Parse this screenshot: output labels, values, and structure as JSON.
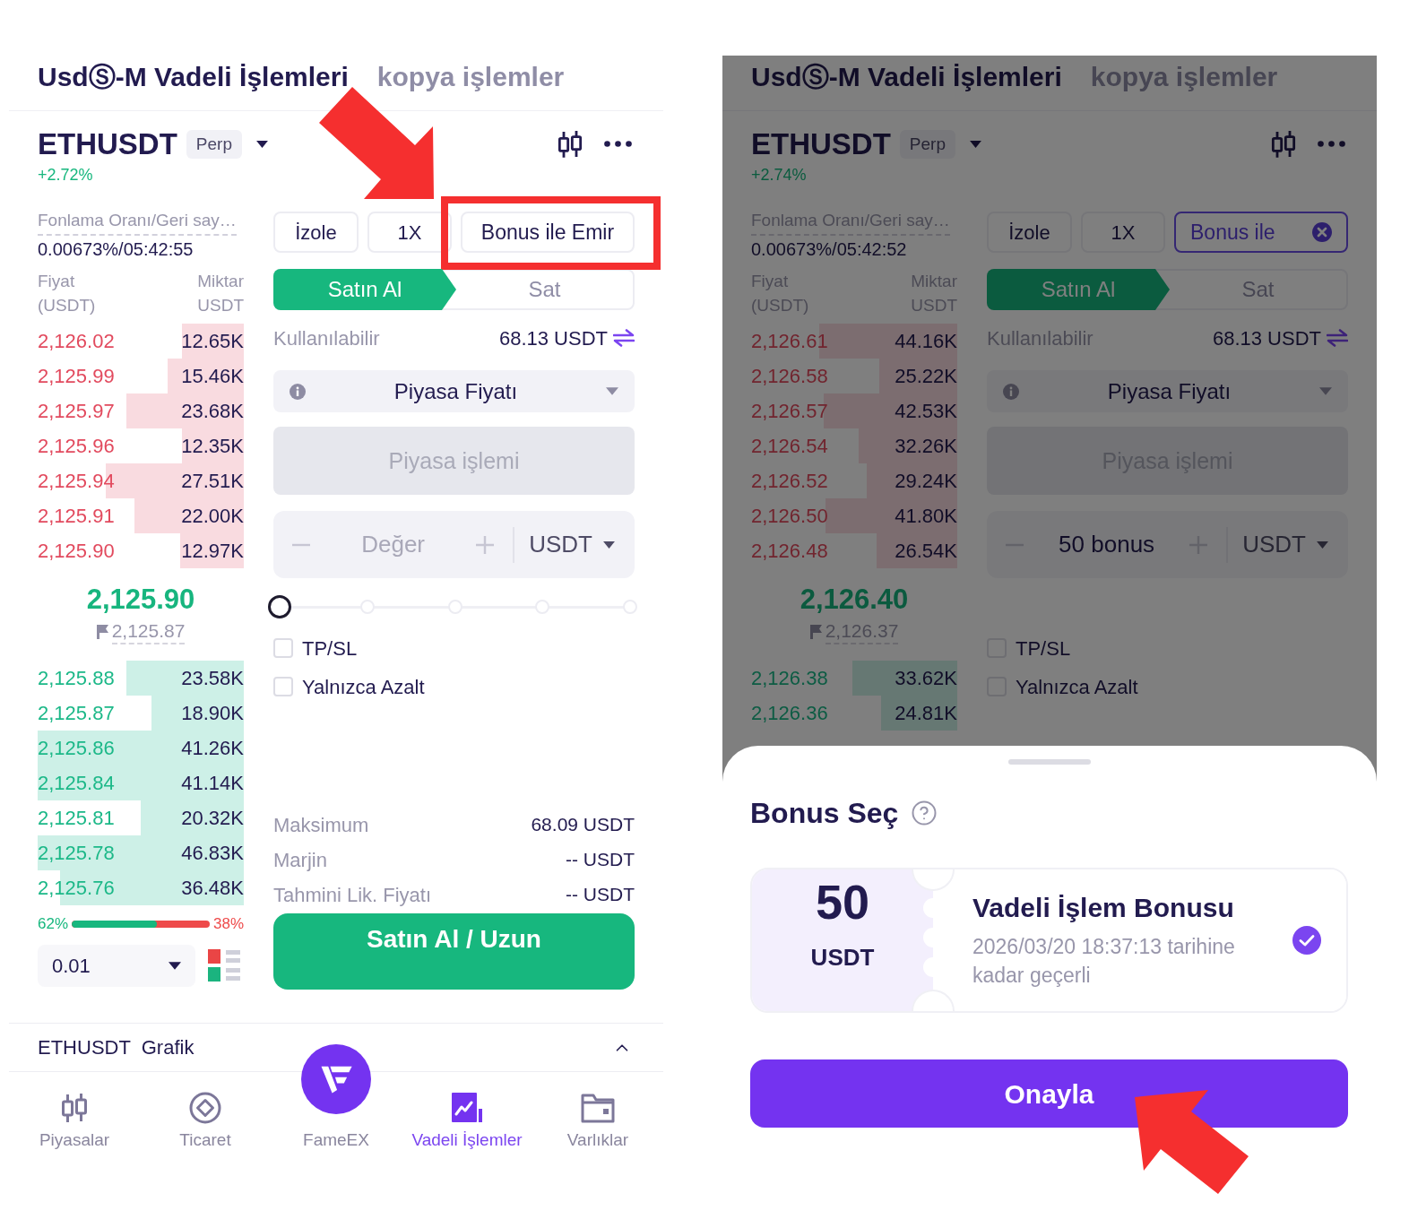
{
  "screens": [
    {
      "header_tabs": [
        {
          "label": "UsdⓈ-M Vadeli İşlemleri",
          "selected": true
        },
        {
          "label": "kopya işlemler",
          "selected": false
        }
      ],
      "symbol": {
        "name": "ETHUSDT",
        "badge": "Perp",
        "change": "+2.72%"
      },
      "funding": {
        "label": "Fonlama Oranı/Geri say…",
        "value": "0.00673%/05:42:55"
      },
      "order_book": {
        "price_label": "Fiyat",
        "price_unit": "(USDT)",
        "amount_label": "Miktar",
        "amount_unit": "USDT",
        "asks": [
          {
            "price": "2,126.02",
            "amount": "12.65K",
            "level": 0.3
          },
          {
            "price": "2,125.99",
            "amount": "15.46K",
            "level": 0.37
          },
          {
            "price": "2,125.97",
            "amount": "23.68K",
            "level": 0.57
          },
          {
            "price": "2,125.96",
            "amount": "12.35K",
            "level": 0.3
          },
          {
            "price": "2,125.94",
            "amount": "27.51K",
            "level": 0.67
          },
          {
            "price": "2,125.91",
            "amount": "22.00K",
            "level": 0.53
          },
          {
            "price": "2,125.90",
            "amount": "12.97K",
            "level": 0.31
          }
        ],
        "last_price": "2,125.90",
        "mark_price": "2,125.87",
        "bids": [
          {
            "price": "2,125.88",
            "amount": "23.58K",
            "level": 0.57
          },
          {
            "price": "2,125.87",
            "amount": "18.90K",
            "level": 0.45
          },
          {
            "price": "2,125.86",
            "amount": "41.26K",
            "level": 1
          },
          {
            "price": "2,125.84",
            "amount": "41.14K",
            "level": 1
          },
          {
            "price": "2,125.81",
            "amount": "20.32K",
            "level": 0.5
          },
          {
            "price": "2,125.78",
            "amount": "46.83K",
            "level": 1
          },
          {
            "price": "2,125.76",
            "amount": "36.48K",
            "level": 0.89
          }
        ],
        "ratio": {
          "buy": "62%",
          "sell": "38%",
          "level": 0.62
        },
        "precision": "0.01"
      },
      "margin_mode": "İzole",
      "leverage": "1X",
      "bonus_button": {
        "label": "Bonus ile Emir",
        "selected": false,
        "callout": true
      },
      "side_tabs": [
        {
          "label": "Satın Al",
          "selected": true
        },
        {
          "label": "Sat",
          "selected": false
        }
      ],
      "available": {
        "label": "Kullanılabilir",
        "value": "68.13 USDT"
      },
      "order_type": "Piyasa Fiyatı",
      "price_field": {
        "placeholder": "Piyasa işlemi",
        "disabled": true
      },
      "amount_field": {
        "placeholder": "Değer",
        "unit": "USDT"
      },
      "slider": {
        "level": 0
      },
      "options": [
        {
          "label": "TP/SL",
          "checked": false
        },
        {
          "label": "Yalnızca Azalt",
          "checked": false
        }
      ],
      "summary": [
        {
          "label": "Maksimum",
          "value": "68.09 USDT"
        },
        {
          "label": "Marjin",
          "value": "-- USDT"
        },
        {
          "label": "Tahmini Lik. Fiyatı",
          "value": "-- USDT"
        }
      ],
      "submit_button": "Satın Al / Uzun",
      "chart_bar": {
        "label": "ETHUSDT  Grafik"
      },
      "bottom_nav": [
        {
          "kind": "markets",
          "label": "Piyasalar",
          "selected": false
        },
        {
          "kind": "trade",
          "label": "Ticaret",
          "selected": false
        },
        {
          "kind": "home",
          "label": "FameEX",
          "selected": false
        },
        {
          "kind": "futures",
          "label": "Vadeli İşlemler",
          "selected": true
        },
        {
          "kind": "assets",
          "label": "Varlıklar",
          "selected": false
        }
      ]
    },
    {
      "header_tabs": [
        {
          "label": "UsdⓈ-M Vadeli İşlemleri",
          "selected": true
        },
        {
          "label": "kopya işlemler",
          "selected": false
        }
      ],
      "symbol": {
        "name": "ETHUSDT",
        "badge": "Perp",
        "change": "+2.74%"
      },
      "funding": {
        "label": "Fonlama Oranı/Geri say…",
        "value": "0.00673%/05:42:52"
      },
      "order_book": {
        "price_label": "Fiyat",
        "price_unit": "(USDT)",
        "amount_label": "Miktar",
        "amount_unit": "USDT",
        "asks": [
          {
            "price": "2,126.61",
            "amount": "44.16K",
            "level": 0.67
          },
          {
            "price": "2,126.58",
            "amount": "25.22K",
            "level": 0.38
          },
          {
            "price": "2,126.57",
            "amount": "42.53K",
            "level": 0.65
          },
          {
            "price": "2,126.54",
            "amount": "32.26K",
            "level": 0.48
          },
          {
            "price": "2,126.52",
            "amount": "29.24K",
            "level": 0.44
          },
          {
            "price": "2,126.50",
            "amount": "41.80K",
            "level": 0.64
          },
          {
            "price": "2,126.48",
            "amount": "26.54K",
            "level": 0.39
          }
        ],
        "last_price": "2,126.40",
        "mark_price": "2,126.37",
        "bids": [
          {
            "price": "2,126.38",
            "amount": "33.62K",
            "level": 0.51
          },
          {
            "price": "2,126.36",
            "amount": "24.81K",
            "level": 0.37
          }
        ]
      },
      "margin_mode": "İzole",
      "leverage": "1X",
      "bonus_button": {
        "label": "Bonus ile",
        "selected": true,
        "callout": false
      },
      "side_tabs": [
        {
          "label": "Satın Al",
          "selected": true
        },
        {
          "label": "Sat",
          "selected": false
        }
      ],
      "available": {
        "label": "Kullanılabilir",
        "value": "68.13 USDT"
      },
      "order_type": "Piyasa Fiyatı",
      "price_field": {
        "placeholder": "Piyasa işlemi",
        "disabled": true
      },
      "amount_field": {
        "value": "50 bonus",
        "unit": "USDT"
      },
      "options": [
        {
          "label": "TP/SL",
          "checked": false
        },
        {
          "label": "Yalnızca Azalt",
          "checked": false
        }
      ],
      "bonus_sheet": {
        "title": "Bonus Seç",
        "bonuses": [
          {
            "amount": "50",
            "unit": "USDT",
            "title": "Vadeli İşlem Bonusu",
            "validity": "2026/03/20 18:37:13 tarihine kadar geçerli",
            "selected": true
          }
        ],
        "confirm_button": {
          "label": "Onayla",
          "callout": true
        }
      }
    }
  ]
}
